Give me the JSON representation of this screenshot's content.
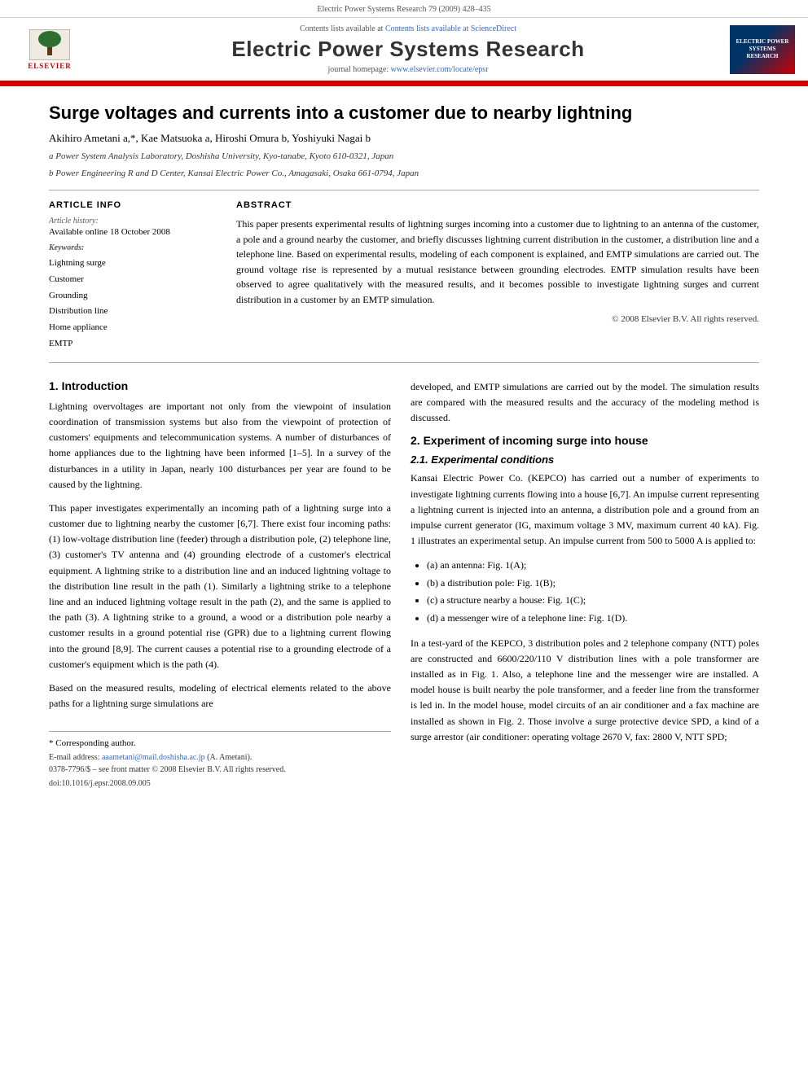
{
  "journal_header": {
    "citation": "Electric Power Systems Research 79 (2009) 428–435"
  },
  "header_banner": {
    "contents_line": "Contents lists available at ScienceDirect",
    "journal_title": "Electric Power Systems Research",
    "homepage_label": "journal homepage:",
    "homepage_url": "www.elsevier.com/locate/epsr",
    "thumbnail_text": "ELECTRIC POWER SYSTEMS RESEARCH",
    "elsevier_label": "ELSEVIER"
  },
  "article": {
    "title": "Surge voltages and currents into a customer due to nearby lightning",
    "authors": "Akihiro Ametani a,*, Kae Matsuoka a, Hiroshi Omura b, Yoshiyuki Nagai b",
    "affiliation_a": "a Power System Analysis Laboratory, Doshisha University, Kyo-tanabe, Kyoto 610-0321, Japan",
    "affiliation_b": "b Power Engineering R and D Center, Kansai Electric Power Co., Amagasaki, Osaka 661-0794, Japan"
  },
  "article_info": {
    "section_label": "ARTICLE INFO",
    "history_label": "Article history:",
    "available_online_label": "Available online 18 October 2008",
    "keywords_label": "Keywords:",
    "keywords": [
      "Lightning surge",
      "Customer",
      "Grounding",
      "Distribution line",
      "Home appliance",
      "EMTP"
    ]
  },
  "abstract": {
    "section_label": "ABSTRACT",
    "text": "This paper presents experimental results of lightning surges incoming into a customer due to lightning to an antenna of the customer, a pole and a ground nearby the customer, and briefly discusses lightning current distribution in the customer, a distribution line and a telephone line. Based on experimental results, modeling of each component is explained, and EMTP simulations are carried out. The ground voltage rise is represented by a mutual resistance between grounding electrodes. EMTP simulation results have been observed to agree qualitatively with the measured results, and it becomes possible to investigate lightning surges and current distribution in a customer by an EMTP simulation.",
    "copyright": "© 2008 Elsevier B.V. All rights reserved."
  },
  "section1": {
    "heading": "1.  Introduction",
    "paragraphs": [
      "Lightning overvoltages are important not only from the viewpoint of insulation coordination of transmission systems but also from the viewpoint of protection of customers' equipments and telecommunication systems. A number of disturbances of home appliances due to the lightning have been informed [1–5]. In a survey of the disturbances in a utility in Japan, nearly 100 disturbances per year are found to be caused by the lightning.",
      "This paper investigates experimentally an incoming path of a lightning surge into a customer due to lightning nearby the customer [6,7]. There exist four incoming paths: (1) low-voltage distribution line (feeder) through a distribution pole, (2) telephone line, (3) customer's TV antenna and (4) grounding electrode of a customer's electrical equipment. A lightning strike to a distribution line and an induced lightning voltage to the distribution line result in the path (1). Similarly a lightning strike to a telephone line and an induced lightning voltage result in the path (2), and the same is applied to the path (3). A lightning strike to a ground, a wood or a distribution pole nearby a customer results in a ground potential rise (GPR) due to a lightning current flowing into the ground [8,9]. The current causes a potential rise to a grounding electrode of a customer's equipment which is the path (4).",
      "Based on the measured results, modeling of electrical elements related to the above paths for a lightning surge simulations are"
    ],
    "continued_right": "developed, and EMTP simulations are carried out by the model. The simulation results are compared with the measured results and the accuracy of the modeling method is discussed."
  },
  "section2": {
    "heading": "2.  Experiment of incoming surge into house",
    "sub_heading": "2.1.  Experimental conditions",
    "paragraphs": [
      "Kansai Electric Power Co. (KEPCO) has carried out a number of experiments to investigate lightning currents flowing into a house [6,7]. An impulse current representing a lightning current is injected into an antenna, a distribution pole and a ground from an impulse current generator (IG, maximum voltage 3 MV, maximum current 40 kA). Fig. 1 illustrates an experimental setup. An impulse current from 500 to 5000 A is applied to:",
      "In a test-yard of the KEPCO, 3 distribution poles and 2 telephone company (NTT) poles are constructed and 6600/220/110 V distribution lines with a pole transformer are installed as in Fig. 1. Also, a telephone line and the messenger wire are installed. A model house is built nearby the pole transformer, and a feeder line from the transformer is led in. In the model house, model circuits of an air conditioner and a fax machine are installed as shown in Fig. 2. Those involve a surge protective device SPD, a kind of a surge arrestor (air conditioner: operating voltage 2670 V, fax: 2800 V, NTT SPD;"
    ],
    "list_items": [
      "(a) an antenna: Fig. 1(A);",
      "(b) a distribution pole: Fig. 1(B);",
      "(c) a structure nearby a house: Fig. 1(C);",
      "(d) a messenger wire of a telephone line: Fig. 1(D)."
    ]
  },
  "footnote": {
    "star_note": "* Corresponding author.",
    "email_label": "E-mail address:",
    "email": "aaametani@mail.doshisha.ac.jp",
    "email_suffix": "(A. Ametani).",
    "issn_line": "0378-7796/$ – see front matter © 2008 Elsevier B.V. All rights reserved.",
    "doi_line": "doi:10.1016/j.epsr.2008.09.005"
  }
}
